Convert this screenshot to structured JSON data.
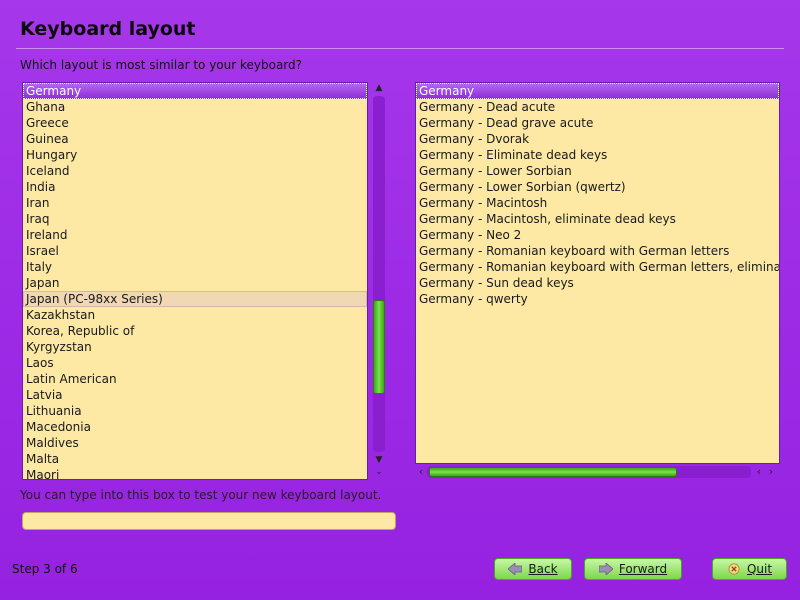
{
  "header": {
    "title": "Keyboard layout",
    "question": "Which layout is most similar to your keyboard?"
  },
  "countries": {
    "items": [
      "Germany",
      "Ghana",
      "Greece",
      "Guinea",
      "Hungary",
      "Iceland",
      "India",
      "Iran",
      "Iraq",
      "Ireland",
      "Israel",
      "Italy",
      "Japan",
      "Japan (PC-98xx Series)",
      "Kazakhstan",
      "Korea, Republic of",
      "Kyrgyzstan",
      "Laos",
      "Latin American",
      "Latvia",
      "Lithuania",
      "Macedonia",
      "Maldives",
      "Malta",
      "Maori"
    ],
    "selected": "Germany",
    "hovered": "Japan (PC-98xx Series)"
  },
  "variants": {
    "items": [
      "Germany",
      "Germany - Dead acute",
      "Germany - Dead grave acute",
      "Germany - Dvorak",
      "Germany - Eliminate dead keys",
      "Germany - Lower Sorbian",
      "Germany - Lower Sorbian (qwertz)",
      "Germany - Macintosh",
      "Germany - Macintosh, eliminate dead keys",
      "Germany - Neo 2",
      "Germany - Romanian keyboard with German letters",
      "Germany - Romanian keyboard with German letters, eliminate dead keys",
      "Germany - Sun dead keys",
      "Germany - qwerty"
    ],
    "selected": "Germany"
  },
  "test_area": {
    "label": "You can type into this box to test your new keyboard layout.",
    "value": ""
  },
  "footer": {
    "step": "Step 3 of 6",
    "back_label": "Back",
    "forward_label": "Forward",
    "quit_label": "Quit"
  },
  "colors": {
    "background": "#9d2be6",
    "list_bg": "#fde9a3",
    "selection": "#8b2cd8",
    "button": "#7bd84c"
  },
  "icons": {
    "back": "arrow-left-icon",
    "forward": "arrow-right-icon",
    "quit": "quit-icon",
    "scroll_up": "chevron-up-icon",
    "scroll_down": "chevron-down-icon",
    "scroll_left": "chevron-left-icon",
    "scroll_right": "chevron-right-icon"
  }
}
